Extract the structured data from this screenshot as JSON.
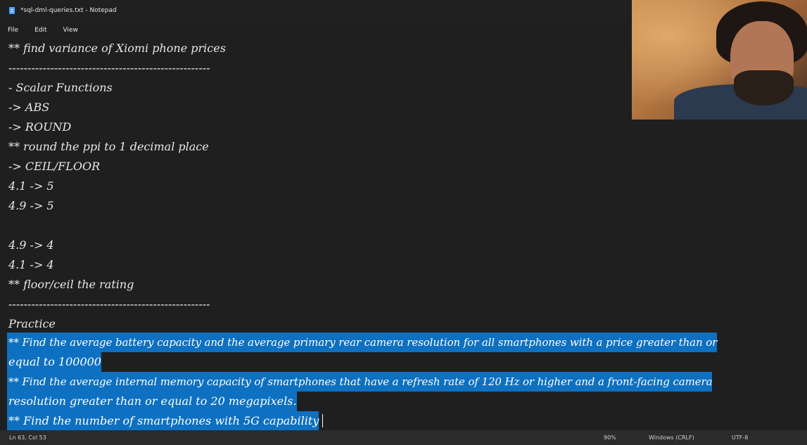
{
  "window": {
    "title": "*sql-dml-queries.txt - Notepad"
  },
  "menu": {
    "file": "File",
    "edit": "Edit",
    "view": "View"
  },
  "editor": {
    "lines": [
      "** find variance of Xiomi phone prices",
      "-----------------------------------------------------",
      "- Scalar Functions",
      "-> ABS",
      "-> ROUND",
      "** round the ppi to 1 decimal place",
      "-> CEIL/FLOOR",
      "4.1 -> 5",
      "4.9 -> 5",
      "",
      "4.9 -> 4",
      "4.1 -> 4",
      "** floor/ceil the rating",
      "-----------------------------------------------------",
      "Practice",
      "** Find the average battery capacity and the average primary rear camera resolution for all smartphones with a price greater than or",
      "equal to 100000",
      "** Find the average internal memory capacity of smartphones that have a refresh rate of 120 Hz or higher and a front-facing camera",
      "resolution greater than or equal to 20 megapixels.",
      "** Find the number of smartphones with 5G capability"
    ],
    "selected_from_line": 15
  },
  "status": {
    "position": "Ln 63, Col 53",
    "zoom": "90%",
    "line_ending": "Windows (CRLF)",
    "encoding": "UTF-8"
  },
  "colors": {
    "background": "#1f1f1f",
    "selection": "#0e70c0",
    "text": "#e8e8e8"
  }
}
